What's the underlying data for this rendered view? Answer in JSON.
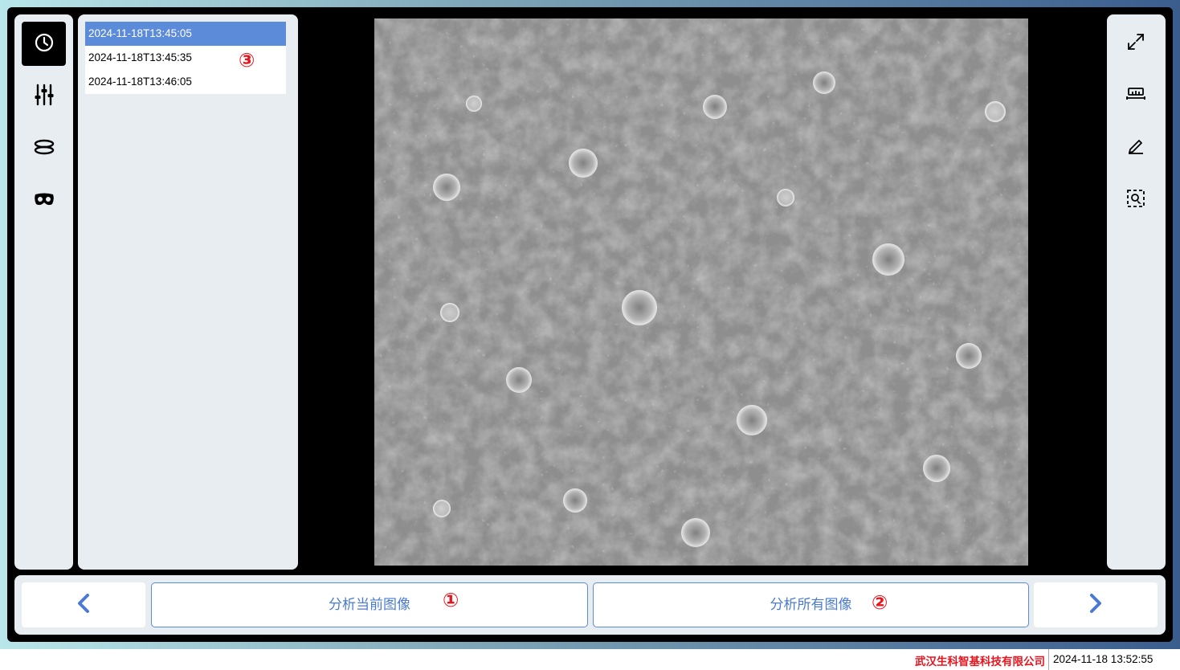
{
  "nav": {
    "items": [
      {
        "name": "history",
        "icon": "clock-icon",
        "active": true
      },
      {
        "name": "adjust",
        "icon": "sliders-icon",
        "active": false
      },
      {
        "name": "layers",
        "icon": "dish-icon",
        "active": false
      },
      {
        "name": "view",
        "icon": "mask-icon",
        "active": false
      }
    ]
  },
  "timestamps": {
    "items": [
      {
        "label": "2024-11-18T13:45:05",
        "selected": true
      },
      {
        "label": "2024-11-18T13:45:35",
        "selected": false
      },
      {
        "label": "2024-11-18T13:46:05",
        "selected": false
      }
    ]
  },
  "markers": {
    "one": "①",
    "two": "②",
    "three": "③"
  },
  "tools": {
    "items": [
      "expand-icon",
      "ruler-icon",
      "pencil-icon",
      "select-region-icon"
    ]
  },
  "actions": {
    "analyze_current": "分析当前图像",
    "analyze_all": "分析所有图像",
    "prev_icon": "chevron-left-icon",
    "next_icon": "chevron-right-icon"
  },
  "status": {
    "company": "武汉生科智基科技有限公司",
    "datetime": "2024-11-18 13:52:55"
  },
  "colors": {
    "accent": "#5b8bd9",
    "marker": "#e8141e",
    "panel": "#e8edf1"
  }
}
